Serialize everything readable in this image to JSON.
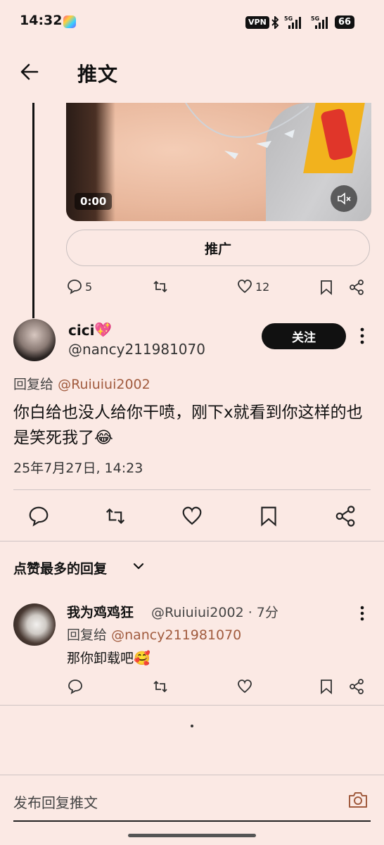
{
  "status_bar": {
    "time": "14:32",
    "vpn": "VPN",
    "battery": "66",
    "network": "5G"
  },
  "header": {
    "title": "推文"
  },
  "parent_tweet": {
    "video_time": "0:00",
    "promote_label": "推广",
    "replies": "5",
    "likes": "12"
  },
  "main_tweet": {
    "display_name": "cici",
    "name_emoji": "💖",
    "handle": "@nancy211981070",
    "follow_label": "关注",
    "reply_prefix": "回复给",
    "reply_mention": "@Ruiuiui2002",
    "text": "你白给也没人给你干喷，刚下x就看到你这样的也是笑死我了😂",
    "date": "25年7月27日, 14:23"
  },
  "sort": {
    "label": "点赞最多的回复"
  },
  "reply": {
    "display_name": "我为鸡鸡狂",
    "handle_time": "@Ruiuiui2002 · 7分",
    "reply_prefix": "回复给",
    "reply_mention": "@nancy211981070",
    "text": "那你卸载吧🥰"
  },
  "composer": {
    "placeholder": "发布回复推文"
  },
  "colors": {
    "background": "#fbe9e4",
    "mention": "#a15b3e",
    "follow_button": "#111111"
  }
}
